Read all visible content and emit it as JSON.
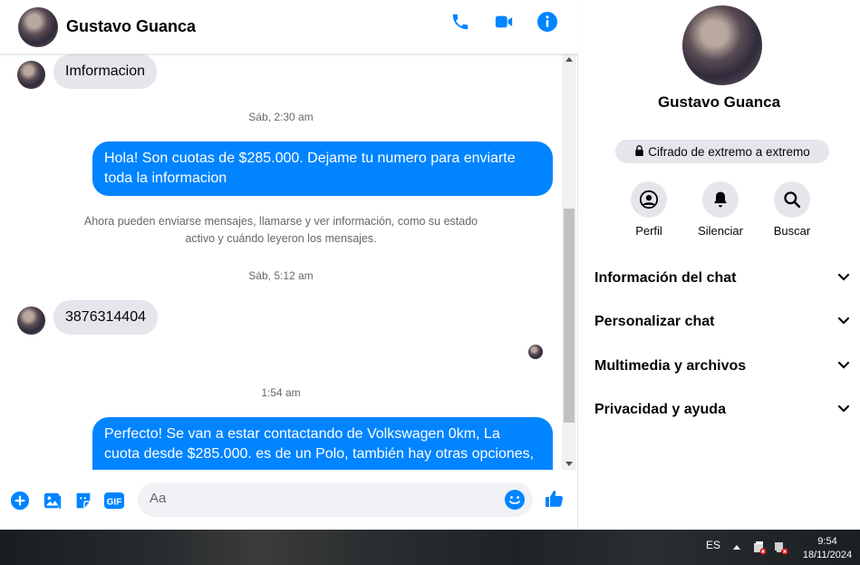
{
  "contact": {
    "name": "Gustavo Guanca"
  },
  "messages": {
    "in_1": "Imformacion",
    "ts_1": "Sáb, 2:30 am",
    "out_1_line1": "Hola! Son cuotas de $285.000. Dejame tu numero para enviarte",
    "out_1_line2": "toda la informacion",
    "system_line1": "Ahora pueden enviarse mensajes, llamarse y ver información, como su estado",
    "system_line2": "activo y cuándo leyeron los mensajes.",
    "ts_2": "Sáb, 5:12 am",
    "in_2": "3876314404",
    "ts_3": "1:54 am",
    "out_2_line1": "Perfecto!  Se van a estar contactando de Volkswagen 0km, La",
    "out_2_line2": "cuota desde $285.000. es de un Polo, también hay otras opciones,"
  },
  "composer": {
    "placeholder": "Aa"
  },
  "panel": {
    "name": "Gustavo Guanca",
    "encryption": "Cifrado de extremo a extremo",
    "actions": [
      {
        "label": "Perfil",
        "icon": "profile-icon"
      },
      {
        "label": "Silenciar",
        "icon": "bell-icon"
      },
      {
        "label": "Buscar",
        "icon": "search-icon"
      }
    ],
    "sections": [
      "Información del chat",
      "Personalizar chat",
      "Multimedia y archivos",
      "Privacidad y ayuda"
    ]
  },
  "taskbar": {
    "language": "ES",
    "time": "9:54",
    "date": "18/11/2024"
  },
  "colors": {
    "accent": "#0084ff",
    "bubble_in": "#e4e6eb",
    "muted_text": "#65676b"
  }
}
